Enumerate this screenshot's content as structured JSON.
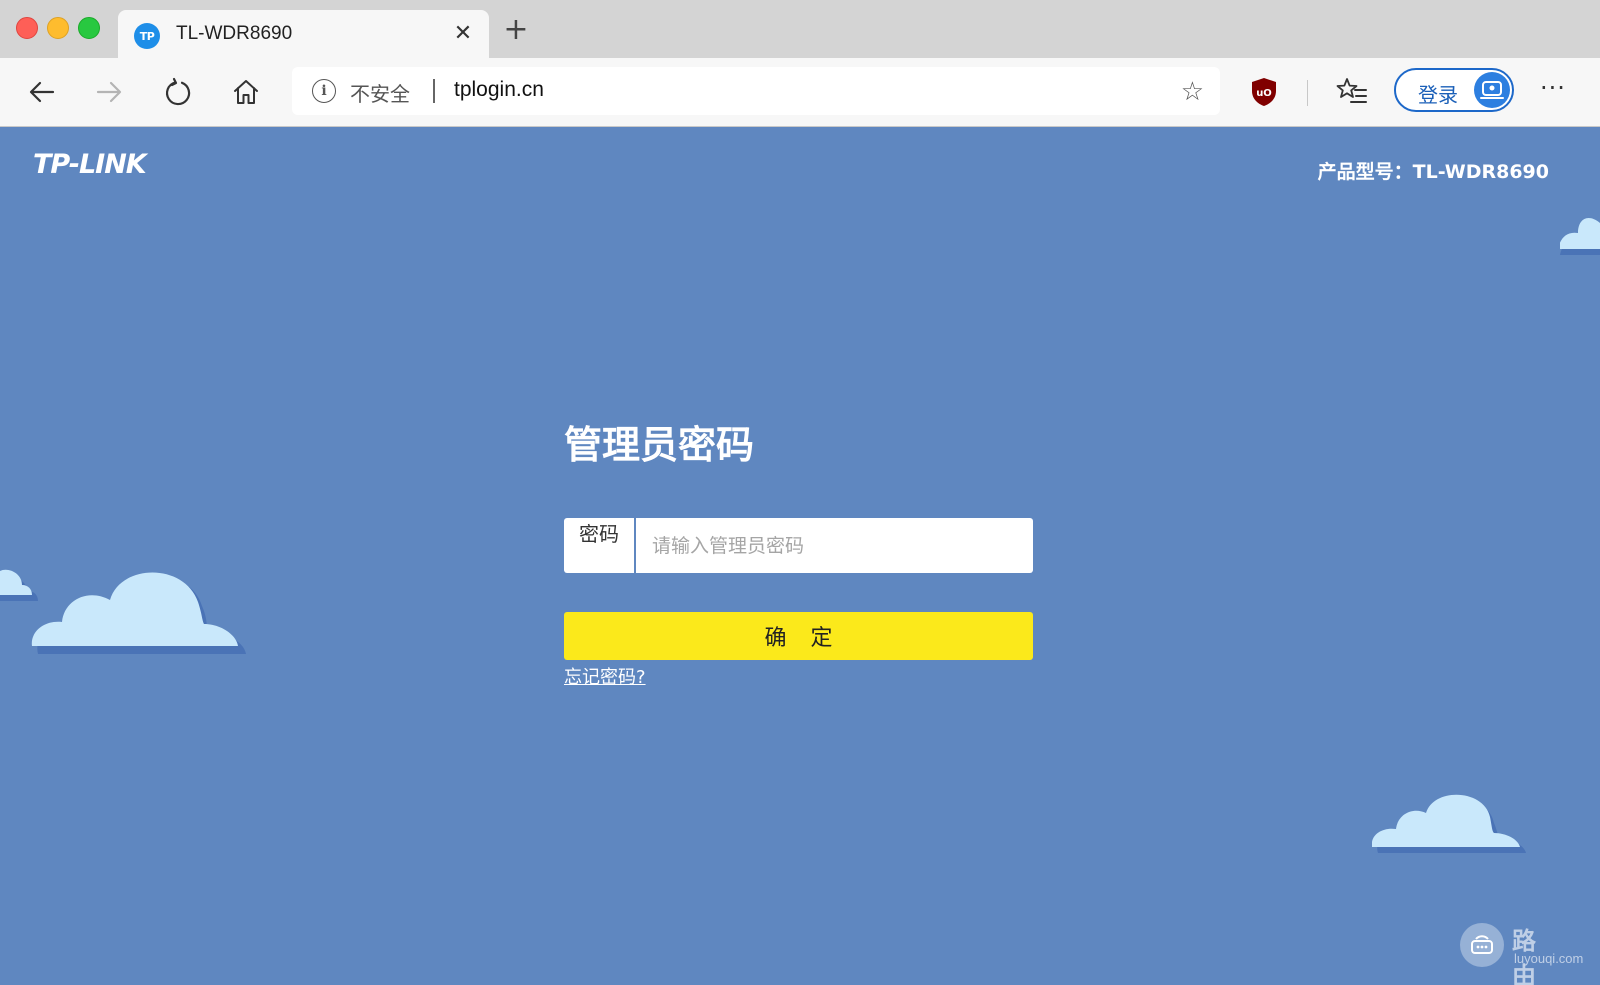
{
  "browser": {
    "tab": {
      "favicon_text": "TP",
      "title": "TL-WDR8690",
      "close_symbol": "✕"
    },
    "new_tab_symbol": "+",
    "address_bar": {
      "security_label": "不安全",
      "url": "tplogin.cn"
    },
    "profile_button_label": "登录",
    "more_symbol": "···"
  },
  "page": {
    "logo": "TP-LINK",
    "model_text": "产品型号：TL-WDR8690",
    "login": {
      "title": "管理员密码",
      "password_label": "密码",
      "password_placeholder": "请输入管理员密码",
      "password_value": "",
      "confirm_label": "确定",
      "forgot_link": "忘记密码?"
    },
    "watermark": {
      "text": "路由器",
      "domain": "luyouqi.com"
    }
  },
  "colors": {
    "page_background": "#5f87c0",
    "confirm_button": "#fbe91b",
    "cloud_light": "#c9e8fb",
    "cloud_shadow": "#4a73b6"
  }
}
